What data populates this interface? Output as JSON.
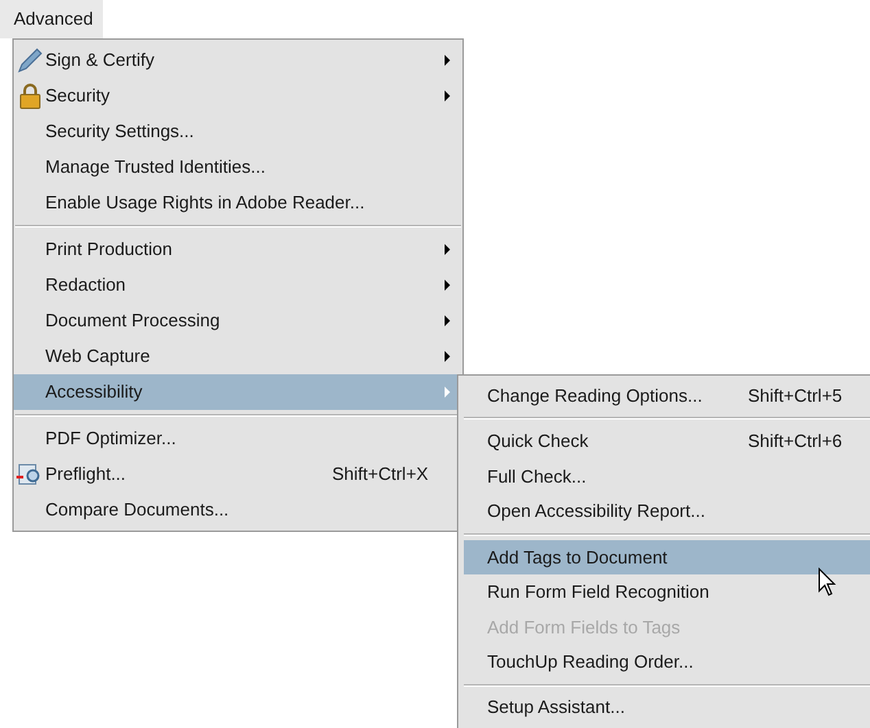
{
  "menu_title": "Advanced",
  "menu": [
    {
      "kind": "item",
      "label": "Sign & Certify",
      "submenu": true,
      "selected": false
    },
    {
      "kind": "item",
      "label": "Security",
      "submenu": true,
      "selected": false
    },
    {
      "kind": "item",
      "label": "Security Settings...",
      "selected": false
    },
    {
      "kind": "item",
      "label": "Manage Trusted Identities...",
      "selected": false
    },
    {
      "kind": "item",
      "label": "Enable Usage Rights in Adobe Reader...",
      "selected": false
    },
    {
      "kind": "separator"
    },
    {
      "kind": "item",
      "label": "Print Production",
      "submenu": true,
      "selected": false
    },
    {
      "kind": "item",
      "label": "Redaction",
      "submenu": true,
      "selected": false
    },
    {
      "kind": "item",
      "label": "Document Processing",
      "submenu": true,
      "selected": false
    },
    {
      "kind": "item",
      "label": "Web Capture",
      "submenu": true,
      "selected": false
    },
    {
      "kind": "item",
      "label": "Accessibility",
      "submenu": true,
      "selected": true
    },
    {
      "kind": "separator"
    },
    {
      "kind": "item",
      "label": "PDF Optimizer...",
      "selected": false
    },
    {
      "kind": "item",
      "label": "Preflight...",
      "shortcut": "Shift+Ctrl+X",
      "selected": false
    },
    {
      "kind": "item",
      "label": "Compare Documents...",
      "selected": false
    }
  ],
  "submenu": [
    {
      "kind": "item",
      "label": "Change Reading Options...",
      "shortcut": "Shift+Ctrl+5",
      "selected": false,
      "disabled": false
    },
    {
      "kind": "separator"
    },
    {
      "kind": "item",
      "label": "Quick Check",
      "shortcut": "Shift+Ctrl+6",
      "selected": false,
      "disabled": false
    },
    {
      "kind": "item",
      "label": "Full Check...",
      "selected": false,
      "disabled": false
    },
    {
      "kind": "item",
      "label": "Open Accessibility Report...",
      "selected": false,
      "disabled": false
    },
    {
      "kind": "separator"
    },
    {
      "kind": "item",
      "label": "Add Tags to Document",
      "selected": true,
      "disabled": false
    },
    {
      "kind": "item",
      "label": "Run Form Field Recognition",
      "selected": false,
      "disabled": false
    },
    {
      "kind": "item",
      "label": "Add Form Fields to Tags",
      "selected": false,
      "disabled": true
    },
    {
      "kind": "item",
      "label": "TouchUp Reading Order...",
      "selected": false,
      "disabled": false
    },
    {
      "kind": "separator"
    },
    {
      "kind": "item",
      "label": "Setup Assistant...",
      "selected": false,
      "disabled": false
    }
  ]
}
